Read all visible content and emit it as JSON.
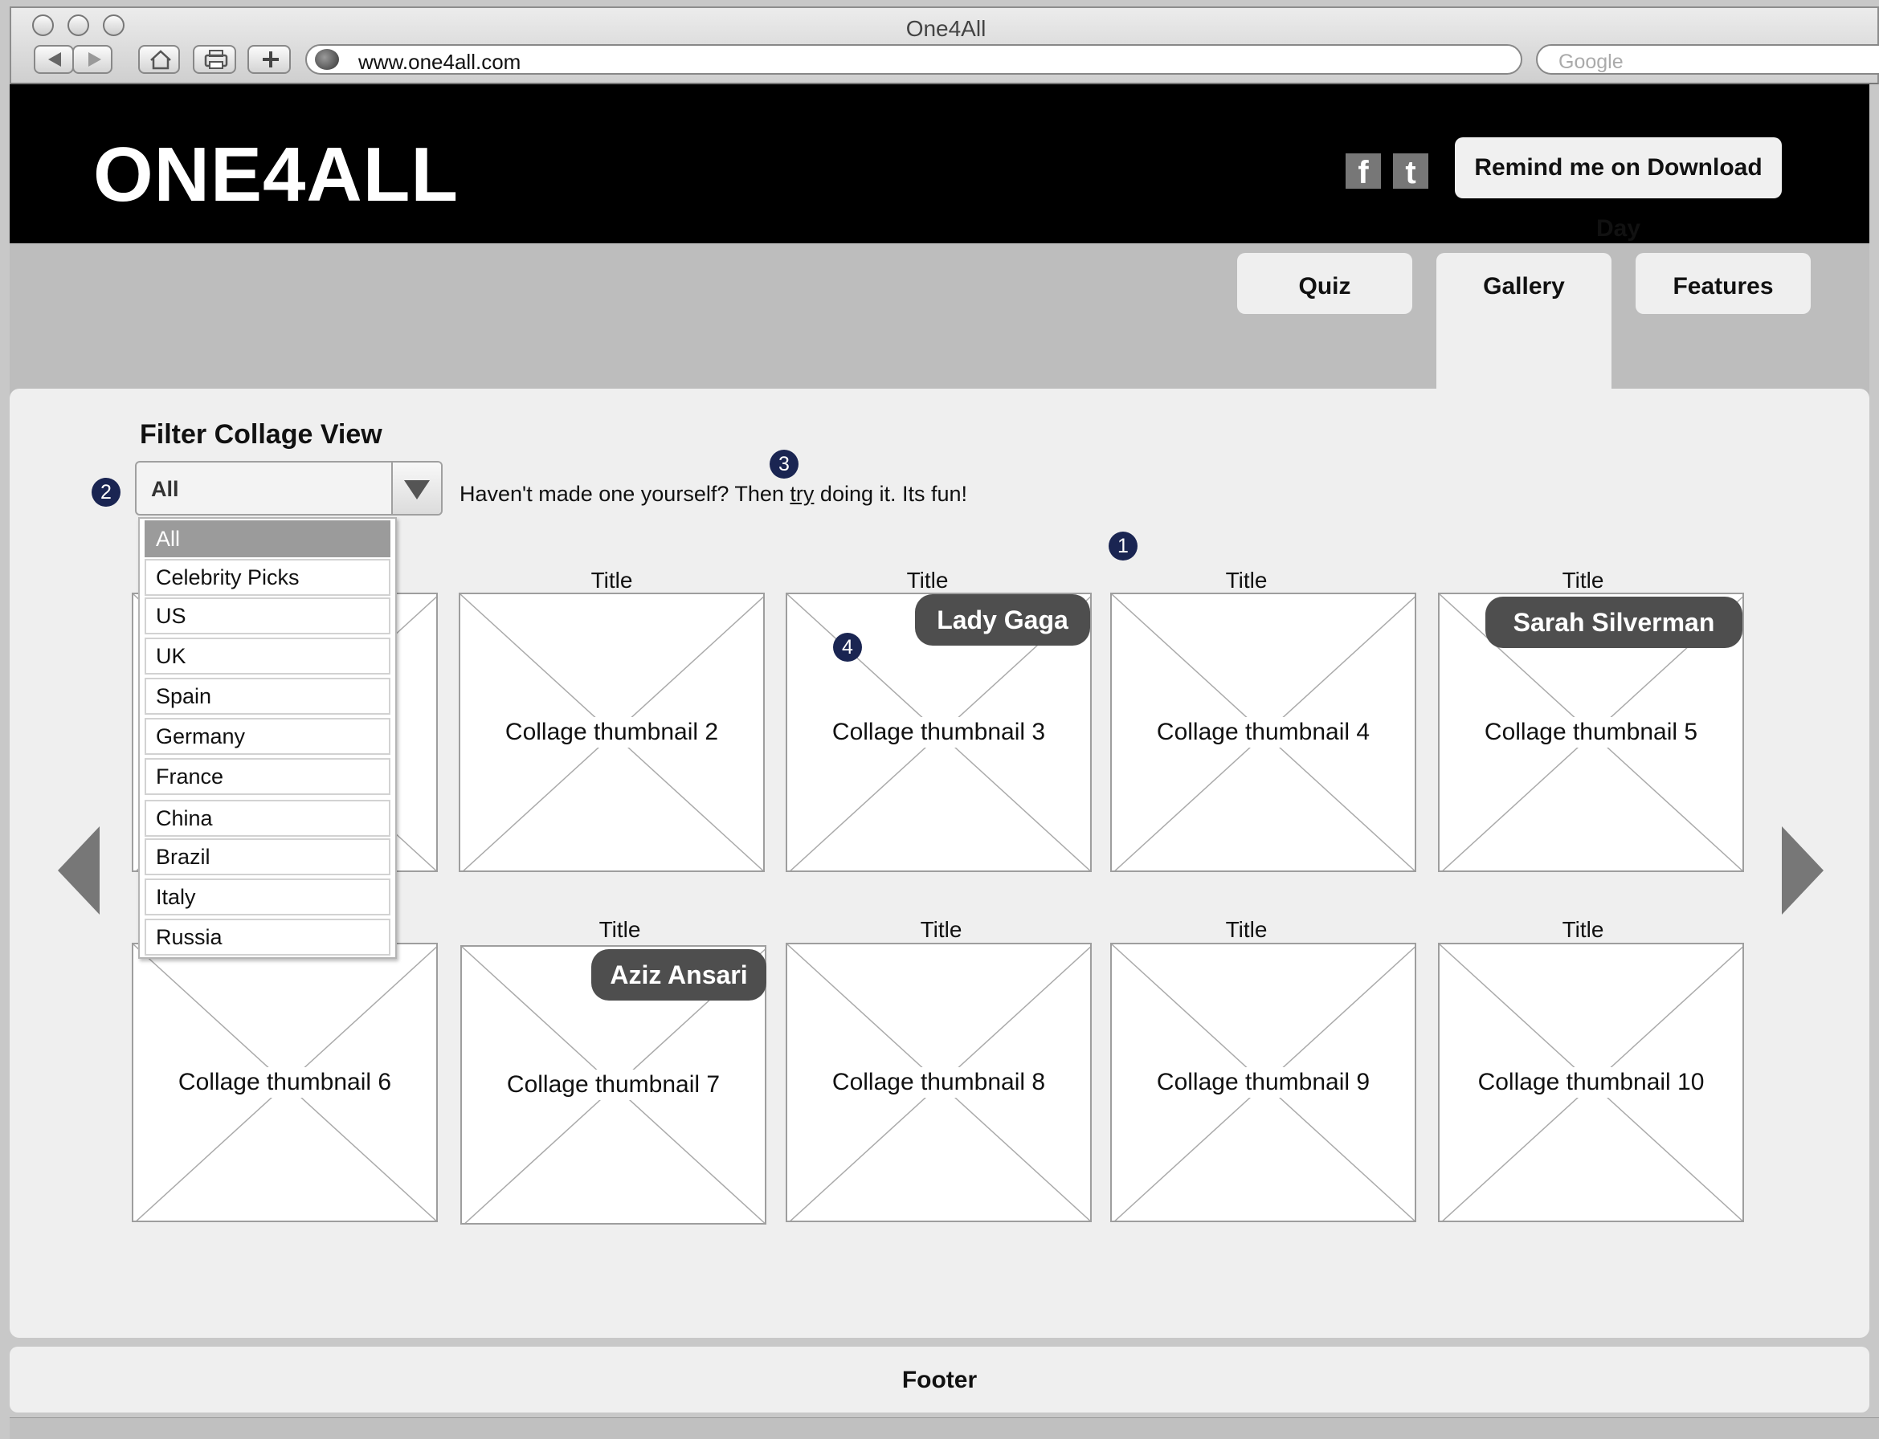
{
  "window": {
    "title": "One4All",
    "url": "www.one4all.com",
    "search_placeholder": "Google"
  },
  "header": {
    "logo": "ONE4ALL",
    "facebook_glyph": "f",
    "twitter_glyph": "t",
    "remind_button": "Remind me on Download Day"
  },
  "tabs": [
    {
      "label": "Quiz",
      "active": false
    },
    {
      "label": "Gallery",
      "active": true
    },
    {
      "label": "Features",
      "active": false
    }
  ],
  "filter": {
    "title": "Filter Collage View",
    "selected": "All",
    "options": [
      "All",
      "Celebrity Picks",
      "US",
      "UK",
      "Spain",
      "Germany",
      "France",
      "China",
      "Brazil",
      "Italy",
      "Russia"
    ],
    "hint_before": "Haven't made one yourself? Then ",
    "hint_link": "try",
    "hint_after": " doing it. Its fun!"
  },
  "badges": [
    "1",
    "2",
    "3",
    "4"
  ],
  "thumbnails": [
    {
      "title": "",
      "label": "",
      "tag": ""
    },
    {
      "title": "Title",
      "label": "Collage thumbnail 2",
      "tag": ""
    },
    {
      "title": "Title",
      "label": "Collage thumbnail 3",
      "tag": "Lady Gaga"
    },
    {
      "title": "Title",
      "label": "Collage thumbnail 4",
      "tag": ""
    },
    {
      "title": "Title",
      "label": "Collage thumbnail 5",
      "tag": "Sarah Silverman"
    },
    {
      "title": "",
      "label": "Collage thumbnail 6",
      "tag": ""
    },
    {
      "title": "Title",
      "label": "Collage thumbnail 7",
      "tag": "Aziz Ansari"
    },
    {
      "title": "Title",
      "label": "Collage thumbnail 8",
      "tag": ""
    },
    {
      "title": "Title",
      "label": "Collage thumbnail 9",
      "tag": ""
    },
    {
      "title": "Title",
      "label": "Collage thumbnail 10",
      "tag": ""
    }
  ],
  "footer": {
    "label": "Footer"
  }
}
